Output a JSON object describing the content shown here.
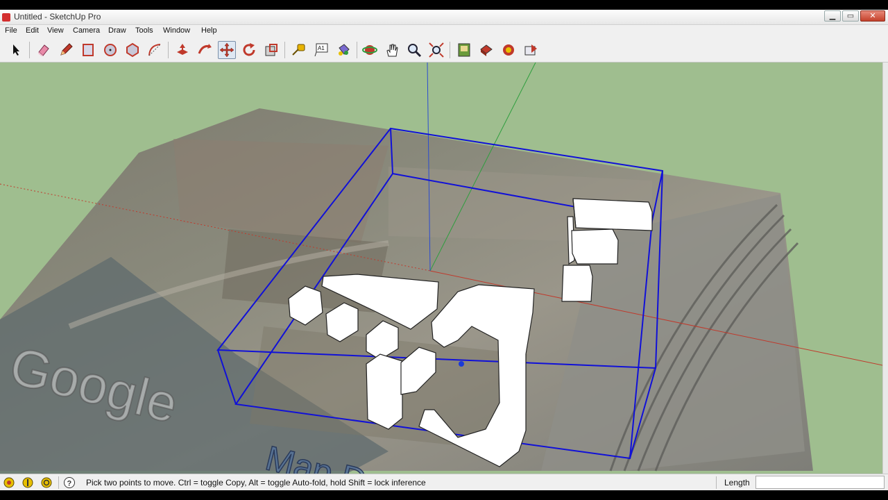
{
  "window": {
    "title": "Untitled - SketchUp Pro"
  },
  "menu": [
    "File",
    "Edit",
    "View",
    "Camera",
    "Draw",
    "Tools",
    "Window",
    "Help"
  ],
  "toolbar": {
    "tools": [
      {
        "id": "select",
        "icon": "arrow-cursor-icon"
      },
      {
        "id": "eraser",
        "icon": "eraser-icon"
      },
      {
        "id": "pencil",
        "icon": "pencil-icon"
      },
      {
        "id": "rectangle",
        "icon": "rectangle-icon"
      },
      {
        "id": "circle",
        "icon": "circle-icon"
      },
      {
        "id": "polygon",
        "icon": "polygon-icon"
      },
      {
        "id": "arc",
        "icon": "arc-icon"
      },
      {
        "id": "push-pull",
        "icon": "push-pull-icon"
      },
      {
        "id": "follow-me",
        "icon": "follow-me-icon"
      },
      {
        "id": "move",
        "icon": "move-icon",
        "active": true
      },
      {
        "id": "rotate",
        "icon": "rotate-icon"
      },
      {
        "id": "scale",
        "icon": "scale-icon"
      },
      {
        "id": "tape-measure",
        "icon": "tape-measure-icon"
      },
      {
        "id": "text",
        "icon": "text-icon",
        "label": "A1"
      },
      {
        "id": "paint-bucket",
        "icon": "paint-bucket-icon"
      },
      {
        "id": "orbit",
        "icon": "orbit-icon"
      },
      {
        "id": "pan",
        "icon": "pan-hand-icon"
      },
      {
        "id": "zoom",
        "icon": "zoom-icon"
      },
      {
        "id": "zoom-extents",
        "icon": "zoom-extents-icon"
      },
      {
        "id": "get-models",
        "icon": "get-models-icon"
      },
      {
        "id": "share-model",
        "icon": "share-model-icon"
      },
      {
        "id": "share-component",
        "icon": "share-component-icon"
      },
      {
        "id": "extension-warehouse",
        "icon": "extension-warehouse-icon"
      }
    ]
  },
  "viewport": {
    "watermark_google": "Google",
    "watermark_map": "Map D"
  },
  "status": {
    "icons": [
      "geo-location-icon",
      "credits-icon",
      "copyright-icon",
      "help-icon"
    ],
    "message": "Pick two points to move.  Ctrl = toggle Copy, Alt = toggle Auto-fold, hold Shift = lock inference",
    "length_label": "Length",
    "length_value": ""
  },
  "colors": {
    "ground": "#9fbe8f",
    "bounding_box": "#1010d8",
    "axis_red": "#c0392b",
    "axis_green": "#2e9e3e",
    "axis_blue": "#2a4bd1"
  }
}
